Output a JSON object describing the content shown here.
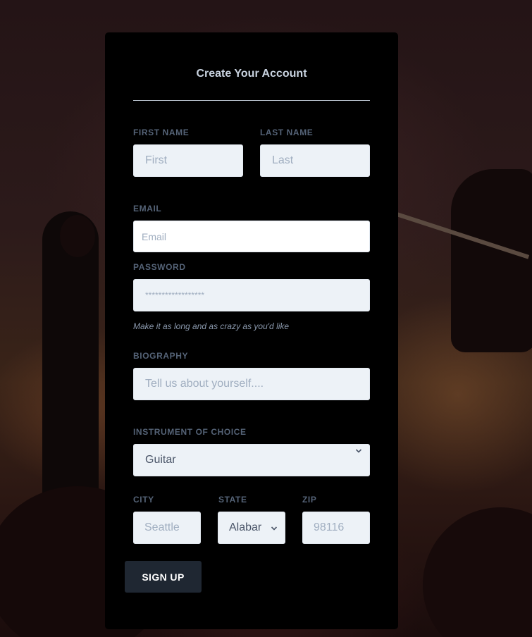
{
  "form": {
    "title": "Create Your Account",
    "first_name": {
      "label": "First Name",
      "placeholder": "First"
    },
    "last_name": {
      "label": "Last Name",
      "placeholder": "Last"
    },
    "email": {
      "label": "Email",
      "placeholder": "Email"
    },
    "password": {
      "label": "Password",
      "placeholder": "******************",
      "hint": "Make it as long and as crazy as you'd like"
    },
    "biography": {
      "label": "Biography",
      "placeholder": "Tell us about yourself...."
    },
    "instrument": {
      "label": "Instrument of Choice",
      "value": "Guitar"
    },
    "city": {
      "label": "City",
      "placeholder": "Seattle"
    },
    "state": {
      "label": "State",
      "value": "Alabar"
    },
    "zip": {
      "label": "Zip",
      "placeholder": "98116"
    },
    "submit_label": "Sign Up"
  },
  "icons": {
    "instrument_chevron": "chevron-down-icon",
    "state_chevron": "chevron-down-icon"
  },
  "colors": {
    "card_bg": "#000000",
    "field_bg": "#edf2f7",
    "label": "#556377",
    "button_bg": "#1f2732"
  }
}
